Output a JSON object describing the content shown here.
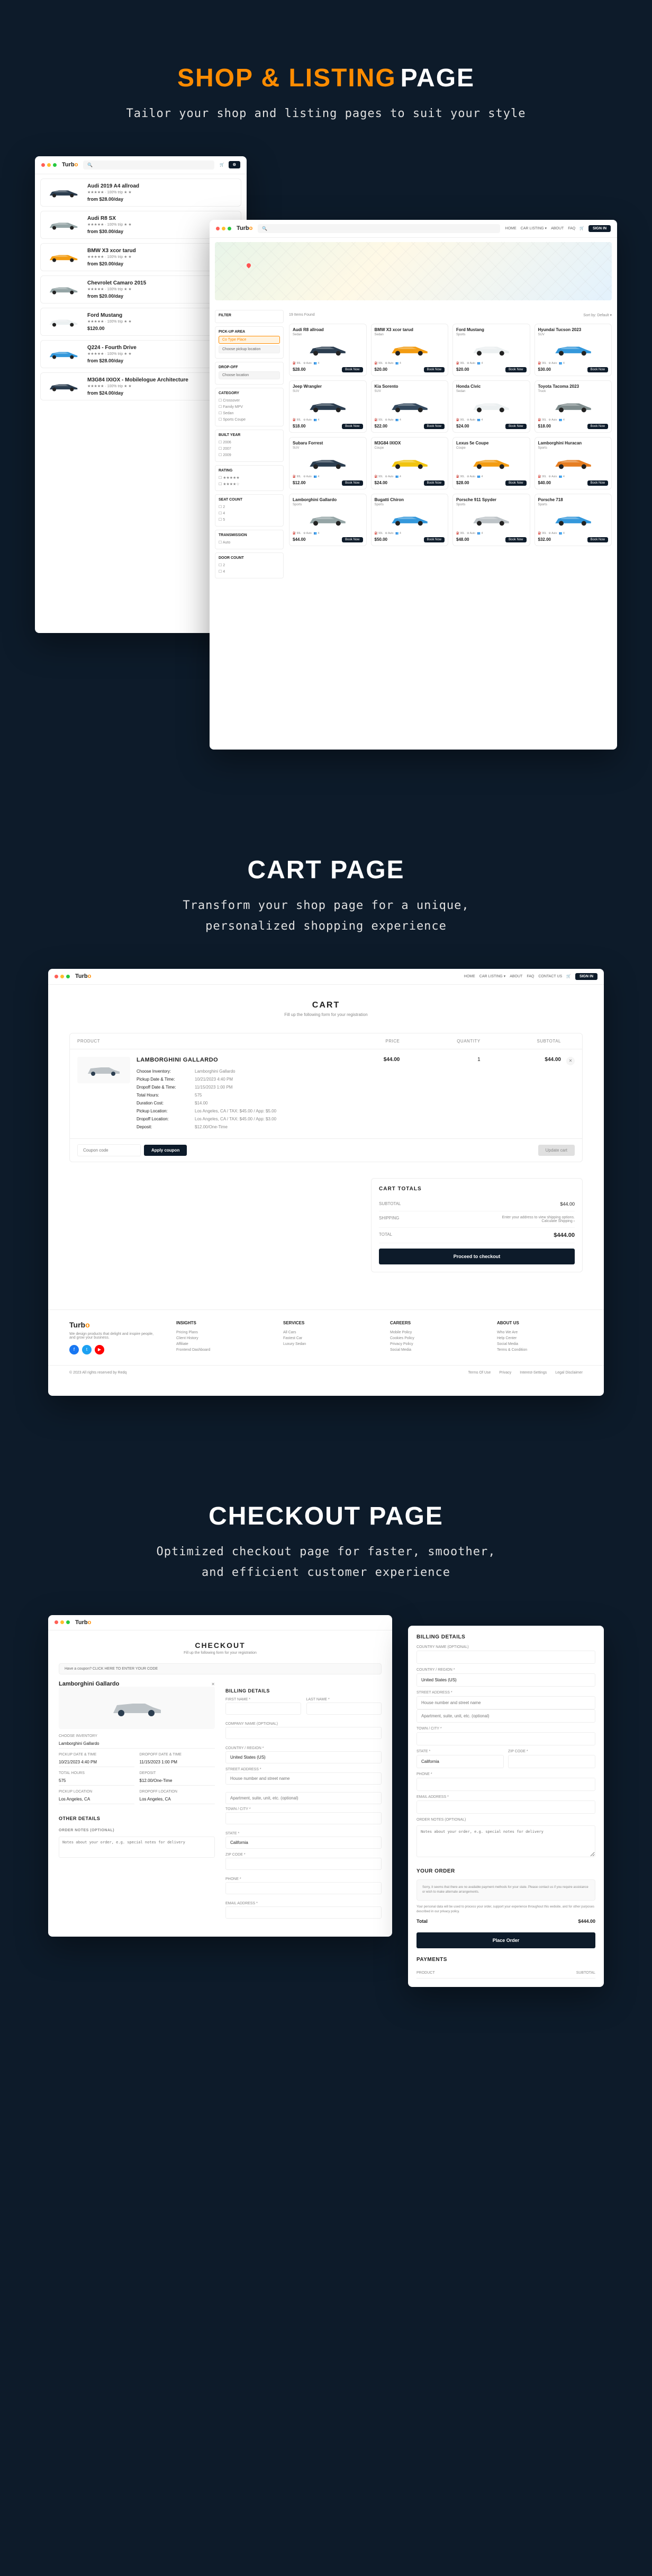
{
  "sections": {
    "shop": {
      "title_orange": "SHOP & LISTING",
      "title_white": "PAGE",
      "desc": "Tailor your shop and listing pages to suit your style"
    },
    "cart": {
      "title_white": "CART PAGE",
      "desc1": "Transform your shop page for a unique,",
      "desc2": "personalized shopping experience"
    },
    "checkout": {
      "title_white": "CHECKOUT PAGE",
      "desc1": "Optimized checkout page for faster, smoother,",
      "desc2": "and efficient customer experience"
    }
  },
  "logo": {
    "text1": "Turb",
    "text2": "o"
  },
  "nav": {
    "home": "HOME",
    "car_listing": "CAR LISTING ▾",
    "about": "ABOUT",
    "faq": "FAQ",
    "contact": "CONTACT US",
    "signin": "SIGN IN"
  },
  "search_placeholder": "Search...",
  "shop_list": [
    {
      "name": "Audi 2019 A4 allroad",
      "price": "from $28.00/day",
      "color": "#2c3e50"
    },
    {
      "name": "Audi R8 SX",
      "price": "from $30.00/day",
      "color": "#95a5a6"
    },
    {
      "name": "BMW X3 xcor tarud",
      "price": "from $20.00/day",
      "color": "#f39c12"
    },
    {
      "name": "Chevrolet Camaro 2015",
      "price": "from $20.00/day",
      "color": "#95a5a6"
    },
    {
      "name": "Ford Mustang",
      "price": "$120.00",
      "color": "#ecf0f1"
    },
    {
      "name": "Q224 - Fourth Drive",
      "price": "from $28.00/day",
      "color": "#3498db"
    },
    {
      "name": "M3G84 IXIOX - Mobilelogue Architecture",
      "price": "from $24.00/day",
      "color": "#2c3e50"
    }
  ],
  "filter": {
    "title": "FILTER",
    "pickup_title": "PICK-UP AREA",
    "pickup1": "Co Type Place",
    "pickup2": "Choose pickup location",
    "dropoff_title": "DROP-OFF",
    "dropoff": "Choose location",
    "cat_title": "Category",
    "cats": [
      "Crossover",
      "Family MPV",
      "Sedan",
      "Sports Coupe"
    ],
    "year_title": "Built Year",
    "rating_title": "Rating",
    "seat_title": "Seat Count",
    "trans_title": "Transmission",
    "door_title": "Door Count"
  },
  "grid_bar": {
    "count": "19 Items Found",
    "sort": "Sort by: Default ▾"
  },
  "grid_cars": [
    {
      "name": "Audi R8 allroad",
      "sub": "Sedan",
      "price": "$28.00",
      "color": "#2c3e50"
    },
    {
      "name": "BMW X3 xcor tarud",
      "sub": "Sedan",
      "price": "$20.00",
      "color": "#f39c12"
    },
    {
      "name": "Ford Mustang",
      "sub": "Sports",
      "price": "$20.00",
      "color": "#ecf0f1"
    },
    {
      "name": "Hyundai Tucson 2023",
      "sub": "SUV",
      "price": "$30.00",
      "color": "#3498db"
    },
    {
      "name": "Jeep Wrangler",
      "sub": "SUV",
      "price": "$18.00",
      "color": "#2c3e50"
    },
    {
      "name": "Kia Sorento",
      "sub": "SUV",
      "price": "$22.00",
      "color": "#34495e"
    },
    {
      "name": "Honda Civic",
      "sub": "Sedan",
      "price": "$24.00",
      "color": "#ecf0f1"
    },
    {
      "name": "Toyota Tacoma 2023",
      "sub": "Truck",
      "price": "$18.00",
      "color": "#7f8c8d"
    },
    {
      "name": "Subaru Forrest",
      "sub": "SUV",
      "price": "$12.00",
      "color": "#2c3e50"
    },
    {
      "name": "M3G84 IXIOX",
      "sub": "Coupe",
      "price": "$24.00",
      "color": "#f1c40f"
    },
    {
      "name": "Lexus 5e Coupe",
      "sub": "Coupe",
      "price": "$28.00",
      "color": "#f39c12"
    },
    {
      "name": "Lamborghini Huracan",
      "sub": "Sports",
      "price": "$40.00",
      "color": "#e67e22"
    },
    {
      "name": "Lamborghini Gallardo",
      "sub": "Sports",
      "price": "$44.00",
      "color": "#95a5a6"
    },
    {
      "name": "Bugatti Chiron",
      "sub": "Sports",
      "price": "$50.00",
      "color": "#3498db"
    },
    {
      "name": "Porsche 911 Spyder",
      "sub": "Sports",
      "price": "$48.00",
      "color": "#bdc3c7"
    },
    {
      "name": "Porsche 718",
      "sub": "Sports",
      "price": "$32.00",
      "color": "#3498db"
    }
  ],
  "grid_btn": "Book Now",
  "cart": {
    "title": "CART",
    "subtitle": "Fill up the following form for your registration",
    "cols": {
      "product": "PRODUCT",
      "price": "PRICE",
      "qty": "QUANTITY",
      "subtotal": "SUBTOTAL"
    },
    "item": {
      "name": "LAMBORGHINI GALLARDO",
      "lines": [
        {
          "lbl": "Choose Inventory:",
          "val": "Lamborghini Gallardo"
        },
        {
          "lbl": "Pickup Date & Time:",
          "val": "10/21/2023 4:40 PM"
        },
        {
          "lbl": "Dropoff Date & Time:",
          "val": "11/15/2023 1:00 PM"
        },
        {
          "lbl": "Total Hours:",
          "val": "575"
        },
        {
          "lbl": "Duration Cost:",
          "val": "$14.00"
        },
        {
          "lbl": "Pickup Location:",
          "val": "Los Angeles, CA / TAX: $45.00 / App: $5.00"
        },
        {
          "lbl": "Dropoff Location:",
          "val": "Los Angeles, CA / TAX: $45.00 / App: $3.00"
        },
        {
          "lbl": "Deposit:",
          "val": "$12.00/One-Time"
        }
      ],
      "price": "$44.00",
      "qty": "1",
      "subtotal": "$44.00"
    },
    "coupon_placeholder": "Coupon code",
    "apply": "Apply coupon",
    "update": "Update cart",
    "totals": {
      "title": "CART TOTALS",
      "subtotal_lbl": "SUBTOTAL",
      "subtotal_val": "$44.00",
      "ship_lbl": "SHIPPING",
      "ship_val": "Enter your address to view shipping options.",
      "ship_link": "Calculate Shipping ›",
      "total_lbl": "TOTAL",
      "total_val": "$444.00",
      "checkout": "Proceed to checkout"
    }
  },
  "footer": {
    "tagline": "We design products that delight and inspire people, and grow your business.",
    "h1": "INSIGHTS",
    "links1": [
      "Pricing Plans",
      "Client History",
      "Affiliate",
      "Frontend Dashboard"
    ],
    "h2": "SERVICES",
    "links2": [
      "All Cars",
      "Fastest Car",
      "Luxury Sedan"
    ],
    "h3": "CAREERS",
    "links3": [
      "Mobile Policy",
      "Cookies Policy",
      "Privacy Policy",
      "Social Media"
    ],
    "h4": "ABOUT US",
    "links4": [
      "Who We Are",
      "Help Center",
      "Social Media",
      "Terms & Condition"
    ],
    "copyright": "© 2023 All rights reserved by Redq",
    "bottom": [
      "Terms Of Use",
      "Privacy",
      "Interest-Settings",
      "Legal Disclaimer"
    ]
  },
  "checkout": {
    "title": "CHECKOUT",
    "subtitle": "Fill up the following form for your registration",
    "banner": "Have a coupon? CLICK HERE TO ENTER YOUR CODE",
    "product": "Lamborghini Gallardo",
    "fields": [
      {
        "lbl": "CHOOSE INVENTORY",
        "val": "Lamborghini Gallardo"
      }
    ],
    "rows": [
      [
        {
          "lbl": "PICKUP DATE & TIME",
          "val": "10/21/2023 4:40 PM"
        },
        {
          "lbl": "DROPOFF DATE & TIME",
          "val": "11/15/2023 1:00 PM"
        }
      ],
      [
        {
          "lbl": "TOTAL HOURS",
          "val": "575"
        },
        {
          "lbl": "DEPOSIT",
          "val": "$12.00/One-Time"
        }
      ],
      [
        {
          "lbl": "PICKUP LOCATION",
          "val": "Los Angeles, CA"
        },
        {
          "lbl": "DROPOFF LOCATION",
          "val": "Los Angeles, CA"
        }
      ]
    ],
    "order_h": "OTHER DETAILS",
    "notes_h": "ORDER NOTES (OPTIONAL)",
    "notes_ph": "Notes about your order, e.g. special notes for delivery",
    "billing_h": "BILLING DETAILS",
    "billing_fields": [
      {
        "lbl": "FIRST NAME *",
        "lbl2": "LAST NAME *"
      },
      {
        "lbl": "COMPANY NAME (OPTIONAL)"
      },
      {
        "lbl": "COUNTRY / REGION *",
        "note": "United States (US)"
      },
      {
        "lbl": "STREET ADDRESS *",
        "ph": "House number and street name"
      },
      {
        "ph": "Apartment, suite, unit, etc. (optional)"
      },
      {
        "lbl": "TOWN / CITY *"
      },
      {
        "lbl": "STATE *",
        "note": "California"
      },
      {
        "lbl": "ZIP CODE *"
      },
      {
        "lbl": "PHONE *"
      },
      {
        "lbl": "EMAIL ADDRESS *"
      }
    ]
  },
  "chk2": {
    "h": "BILLING DETAILS",
    "label_lbl": "COUNTRY NAME (OPTIONAL)",
    "country_lbl": "COUNTRY / REGION *",
    "country_val": "United States (US)",
    "street_lbl": "STREET ADDRESS *",
    "street_ph": "House number and street name",
    "apt_ph": "Apartment, suite, unit, etc. (optional)",
    "city_lbl": "TOWN / CITY *",
    "state_lbl": "STATE *",
    "state_val": "California",
    "zip_lbl": "ZIP CODE *",
    "phone_lbl": "PHONE *",
    "email_lbl": "EMAIL ADDRESS *",
    "notes_lbl": "ORDER NOTES (OPTIONAL)",
    "notes_ph": "Notes about your order, e.g. special notes for delivery",
    "order_h": "YOUR ORDER",
    "box_text": "Sorry, it seems that there are no available payment methods for your state. Please contact us if you require assistance or wish to make alternate arrangements.",
    "privacy": "Your personal data will be used to process your order, support your experience throughout this website, and for other purposes described in our privacy policy.",
    "total_lbl": "Total",
    "total_val": "$444.00",
    "place": "Place Order",
    "payments_h": "PAYMENTS",
    "product_lbl": "PRODUCT",
    "subtotal_lbl": "SUBTOTAL"
  }
}
